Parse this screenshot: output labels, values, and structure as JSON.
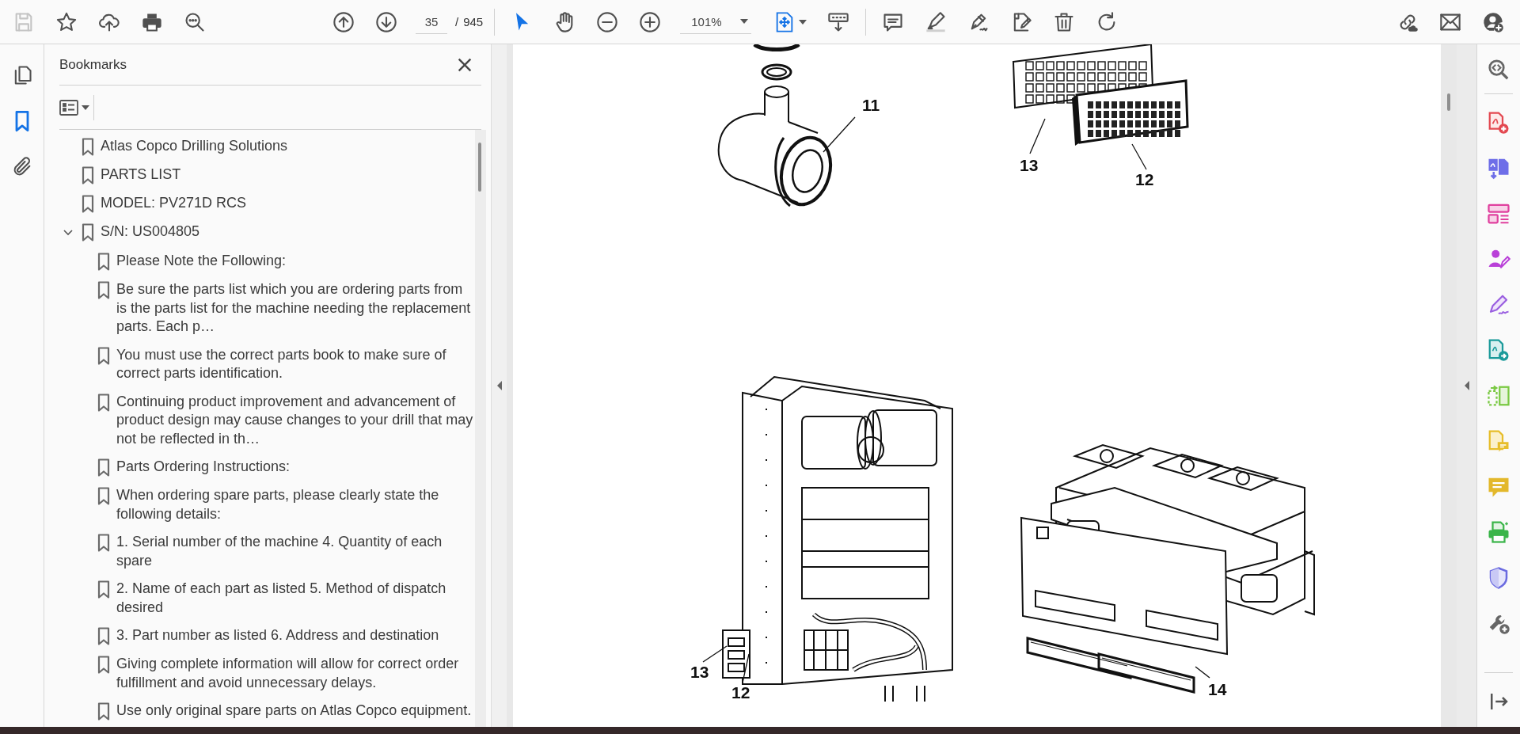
{
  "toolbar": {
    "save": {
      "disabled": true
    },
    "page_number": "35",
    "page_separator": "/",
    "page_total": "945",
    "tools": [
      {
        "kind": "select",
        "selected": true
      },
      {
        "kind": "hand",
        "selected": false
      }
    ],
    "zoom": "101%"
  },
  "left_rail": {
    "tabs": [
      {
        "kind": "pages",
        "selected": false
      },
      {
        "kind": "bookmarks",
        "selected": true
      },
      {
        "kind": "attachments",
        "selected": false
      }
    ]
  },
  "bookmarks": {
    "title": "Bookmarks",
    "items": [
      {
        "label": "Atlas Copco Drilling Solutions"
      },
      {
        "label": "PARTS LIST"
      },
      {
        "label": "MODEL: PV271D RCS"
      },
      {
        "label": "S/N: US004805",
        "expanded": true,
        "children": [
          {
            "label": "Please Note the Following:"
          },
          {
            "label": "Be sure the parts list which you are ordering parts from is the parts list for the machine needing the replacement parts. Each p…"
          },
          {
            "label": "You must use the correct parts book to make sure of correct parts identification."
          },
          {
            "label": "Continuing product improvement and advancement of product design may cause changes to your drill that may not be reflected in th…"
          },
          {
            "label": "Parts Ordering Instructions:"
          },
          {
            "label": "When ordering spare parts, please clearly state the following details:"
          },
          {
            "label": "1. Serial number of the machine 4. Quantity of each spare"
          },
          {
            "label": "2. Name of each part as listed 5. Method of dispatch desired"
          },
          {
            "label": "3. Part number as listed 6. Address and destination"
          },
          {
            "label": "Giving complete information will allow for correct order fulfillment and avoid unnecessary delays."
          },
          {
            "label": "Use only original spare parts on Atlas Copco equipment."
          }
        ]
      }
    ]
  },
  "page": {
    "callouts": [
      {
        "number": "11"
      },
      {
        "number": "13"
      },
      {
        "number": "12"
      },
      {
        "number": "13"
      },
      {
        "number": "12"
      },
      {
        "number": "14"
      }
    ]
  }
}
